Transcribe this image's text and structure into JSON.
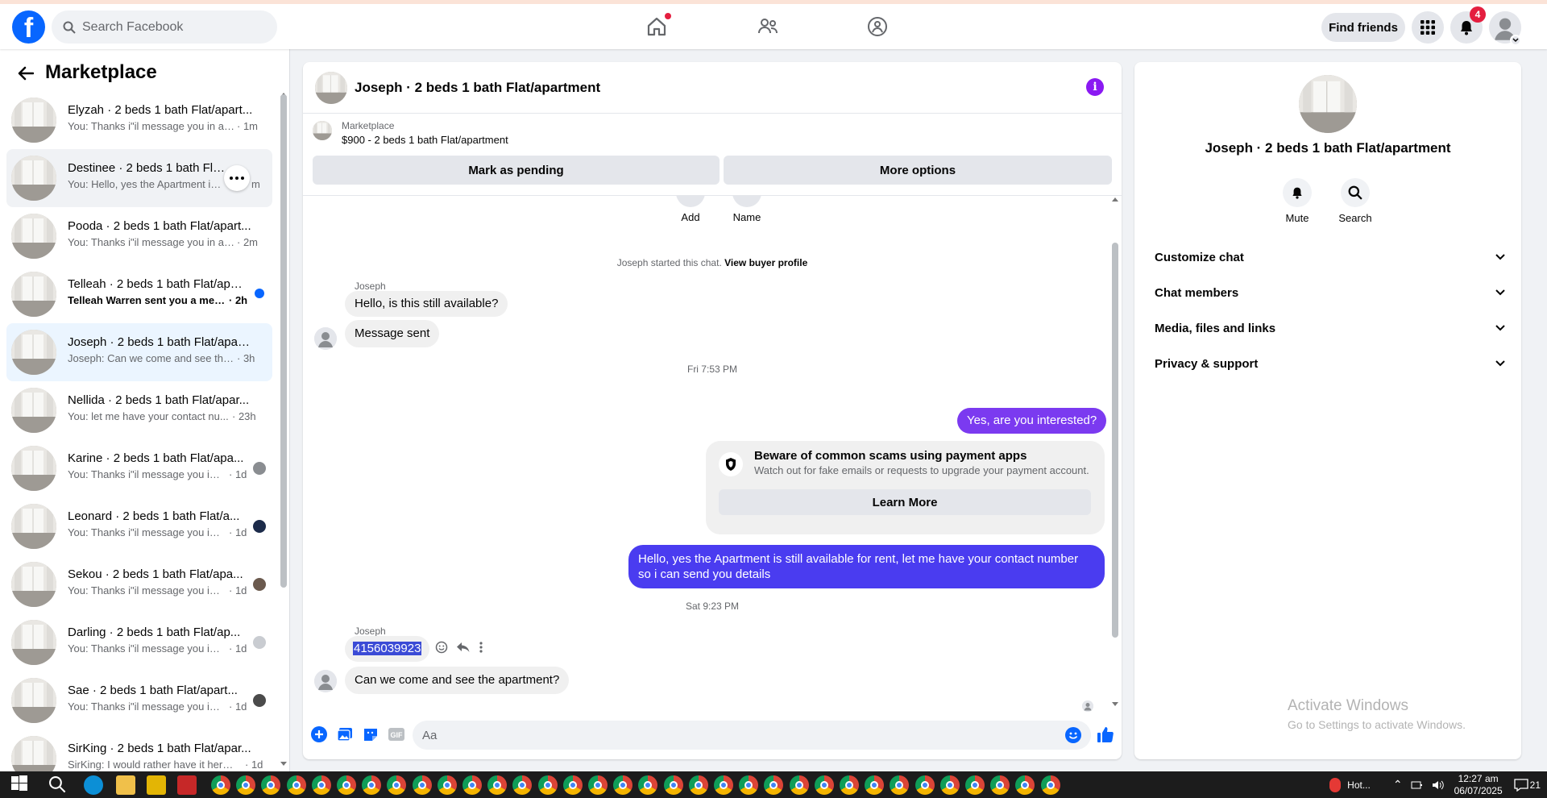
{
  "topbar": {
    "logo": "f",
    "search_placeholder": "Search Facebook",
    "find_friends": "Find friends",
    "notification_count": "4"
  },
  "marketplace": {
    "title": "Marketplace",
    "conversations": [
      {
        "title": "Elyzah · 2 beds 1 bath Flat/apart...",
        "preview": "You: Thanks i\"il message you in a ...",
        "time": "· 1m"
      },
      {
        "title": "Destinee · 2 beds 1 bath Flat/...",
        "preview": "You: Hello, yes the Apartment is s...",
        "time": "m"
      },
      {
        "title": "Pooda · 2 beds 1 bath Flat/apart...",
        "preview": "You: Thanks i\"il message you in a ...",
        "time": "· 2m"
      },
      {
        "title": "Telleah · 2 beds 1 bath Flat/apa...",
        "preview": "Telleah Warren sent you a mess...",
        "time": "· 2h"
      },
      {
        "title": "Joseph · 2 beds 1 bath Flat/apart...",
        "preview": "Joseph: Can we come and see the ...",
        "time": "· 3h"
      },
      {
        "title": "Nellida · 2 beds 1 bath Flat/apar...",
        "preview": "You: let me have your contact nu...",
        "time": "· 23h"
      },
      {
        "title": "Karine · 2 beds 1 bath Flat/apa...",
        "preview": "You: Thanks i\"il message you in ...",
        "time": "· 1d"
      },
      {
        "title": "Leonard · 2 beds 1 bath Flat/a...",
        "preview": "You: Thanks i\"il message you in ...",
        "time": "· 1d"
      },
      {
        "title": "Sekou · 2 beds 1 bath Flat/apa...",
        "preview": "You: Thanks i\"il message you in ...",
        "time": "· 1d"
      },
      {
        "title": "Darling · 2 beds 1 bath Flat/ap...",
        "preview": "You: Thanks i\"il message you in ...",
        "time": "· 1d"
      },
      {
        "title": "Sae · 2 beds 1 bath Flat/apart...",
        "preview": "You: Thanks i\"il message you in ...",
        "time": "· 1d"
      },
      {
        "title": "SirKing · 2 beds 1 bath Flat/apar...",
        "preview": "SirKing: I would rather have it here ...",
        "time": "· 1d"
      }
    ]
  },
  "chat": {
    "title": "Joseph · 2 beds 1 bath Flat/apartment",
    "listing_source": "Marketplace",
    "listing_price": "$900 - 2 beds 1 bath Flat/apartment",
    "mark_pending": "Mark as pending",
    "more_options": "More options",
    "add_label": "Add",
    "name_label": "Name",
    "started_text": "Joseph started this chat.",
    "view_buyer": "View buyer profile",
    "sender_name": "Joseph",
    "msg_in_1": "Hello, is this still available?",
    "msg_in_2": "Message sent",
    "timestamp_1": "Fri 7:53 PM",
    "msg_out_1": "Yes, are you interested?",
    "scam_title": "Beware of common scams using payment apps",
    "scam_sub": "Watch out for fake emails or requests to upgrade your payment account.",
    "learn_more": "Learn More",
    "msg_out_2a": "Hello, yes the Apartment is still available for rent, let me have your contact number",
    "msg_out_2b": "so i can send you details",
    "timestamp_2": "Sat 9:23 PM",
    "msg_in_3": "4156039923",
    "msg_in_4": "Can we come and see the apartment?",
    "composer_placeholder": "Aa"
  },
  "details": {
    "title": "Joseph · 2 beds 1 bath Flat/apartment",
    "mute": "Mute",
    "search": "Search",
    "sections": [
      "Customize chat",
      "Chat members",
      "Media, files and links",
      "Privacy & support"
    ]
  },
  "watermark": {
    "line1": "Activate Windows",
    "line2": "Go to Settings to activate Windows."
  },
  "taskbar": {
    "hot_label": "Hot...",
    "time": "12:27 am",
    "date": "06/07/2025",
    "notif": "21"
  },
  "colors": {
    "fb_blue": "#0866ff",
    "outgoing_bubble": "#7b3af0",
    "outgoing_bubble_2": "#4a3cf0",
    "badge_red": "#e41e3f"
  }
}
